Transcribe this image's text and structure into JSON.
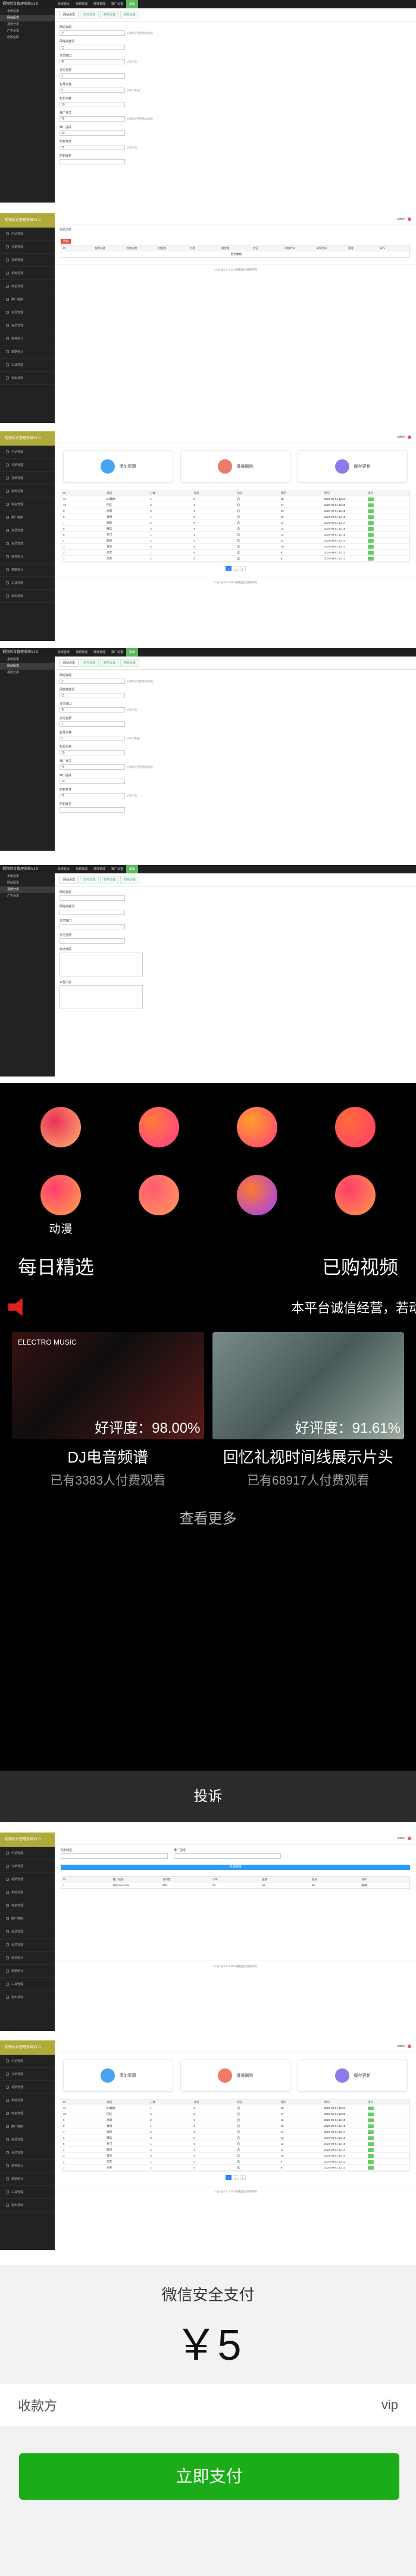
{
  "admin": {
    "brand": "视频后台管理系统V1.0",
    "topnav": [
      "系统首页",
      "视频管理",
      "链接管理",
      "推广设置",
      "退出"
    ],
    "user": "admin",
    "side_subs": [
      "系统设置",
      "网站配置",
      "视频分类",
      "广告设置",
      "修改密码"
    ],
    "side_items": [
      "产品管理",
      "订单管理",
      "视频管理",
      "系统设置",
      "域名管理",
      "推广链接",
      "资源管理",
      "会员管理",
      "财务统计",
      "数据统计",
      "工具管理",
      "退出系统"
    ],
    "tabs": [
      "网站设置",
      "支付设置",
      "邮件设置",
      "视频设置"
    ],
    "form_labels": [
      "网站标题",
      "网站关键词",
      "支付接口",
      "支付金额",
      "包月价格",
      "包年价格",
      "推广开关",
      "推广提成",
      "防封开关",
      "防封域名",
      "统计代码",
      "公告内容"
    ],
    "form_values": [
      "小",
      "已",
      "卖",
      "1",
      "5",
      "10",
      "开",
      "30",
      "开",
      "",
      "",
      ""
    ],
    "form_hints": [
      "(请填写完整网站地址)",
      "(支付通道自行配置)",
      "(单位元)",
      "(开关)",
      "(填写域名)",
      "(统计代码会显示在底部)"
    ],
    "crumb": "视频列表",
    "red_btn": "添加",
    "table1_headers": [
      "ID",
      "视频标题",
      "视频分类",
      "封面图",
      "价格",
      "播放量",
      "状态",
      "添加时间",
      "操作时间",
      "管理",
      "操作"
    ],
    "table1_empty": "暂无数据",
    "copyright": "Copyright © 2023 视频后台 版权所有",
    "cards": [
      "添加资源",
      "批量删除",
      "缓存更新"
    ],
    "table2_headers": [
      "ID",
      "标题",
      "分类",
      "价格",
      "状态",
      "排序",
      "时间",
      "操作"
    ],
    "table2_rows": [
      [
        "11",
        "DJ舞曲",
        "1",
        "5",
        "启",
        "18",
        "2023-09-01 12:21"
      ],
      [
        "10",
        "回忆",
        "2",
        "5",
        "启",
        "17",
        "2023-09-01 12:20"
      ],
      [
        "9",
        "动漫",
        "3",
        "5",
        "启",
        "16",
        "2023-09-01 12:19"
      ],
      [
        "8",
        "直播",
        "1",
        "5",
        "启",
        "15",
        "2023-09-01 12:18"
      ],
      [
        "7",
        "短剧",
        "2",
        "5",
        "启",
        "14",
        "2023-09-01 12:17"
      ],
      [
        "6",
        "精选",
        "3",
        "5",
        "启",
        "13",
        "2023-09-01 12:16"
      ],
      [
        "5",
        "热门",
        "1",
        "5",
        "启",
        "12",
        "2023-09-01 12:15"
      ],
      [
        "4",
        "影视",
        "2",
        "5",
        "启",
        "11",
        "2023-09-01 12:14"
      ],
      [
        "3",
        "音乐",
        "3",
        "5",
        "启",
        "10",
        "2023-09-01 12:13"
      ],
      [
        "2",
        "综艺",
        "1",
        "5",
        "启",
        "9",
        "2023-09-01 12:12"
      ],
      [
        "1",
        "体育",
        "2",
        "5",
        "启",
        "8",
        "2023-09-01 12:11"
      ]
    ],
    "pager": [
      "1",
      "2",
      "3"
    ],
    "link_headers": [
      "ID",
      "推广链接",
      "访问量",
      "订单",
      "金额",
      "提成",
      "操作"
    ],
    "link_row": [
      "1",
      "http://xxx.com",
      "852",
      "13",
      "65",
      "30",
      "编辑"
    ],
    "link_btn": "生成链接"
  },
  "mobile": {
    "icons": [
      "",
      "",
      "",
      "",
      "动漫",
      "",
      "",
      ""
    ],
    "sections": [
      "每日精选",
      "已购视频"
    ],
    "marquee": "本平台诚信经营，若动",
    "videos": [
      {
        "title": "DJ电音频谱",
        "score": "好评度：98.00%",
        "buyers": "已有3383人付费观看",
        "banner": "ELECTRO MUSIC"
      },
      {
        "title": "回忆礼视时间线展示片头",
        "score": "好评度：91.61%",
        "buyers": "已有68917人付费观看",
        "banner": ""
      }
    ],
    "more": "查看更多",
    "complain": "投诉"
  },
  "pay": {
    "title": "微信安全支付",
    "amount": "￥5",
    "payee_label": "收款方",
    "payee": "vip",
    "button": "立即支付"
  },
  "colors": {
    "wechat_green": "#1aad19",
    "admin_green": "#5cb85c",
    "logo_olive": "#b0aa3a"
  }
}
